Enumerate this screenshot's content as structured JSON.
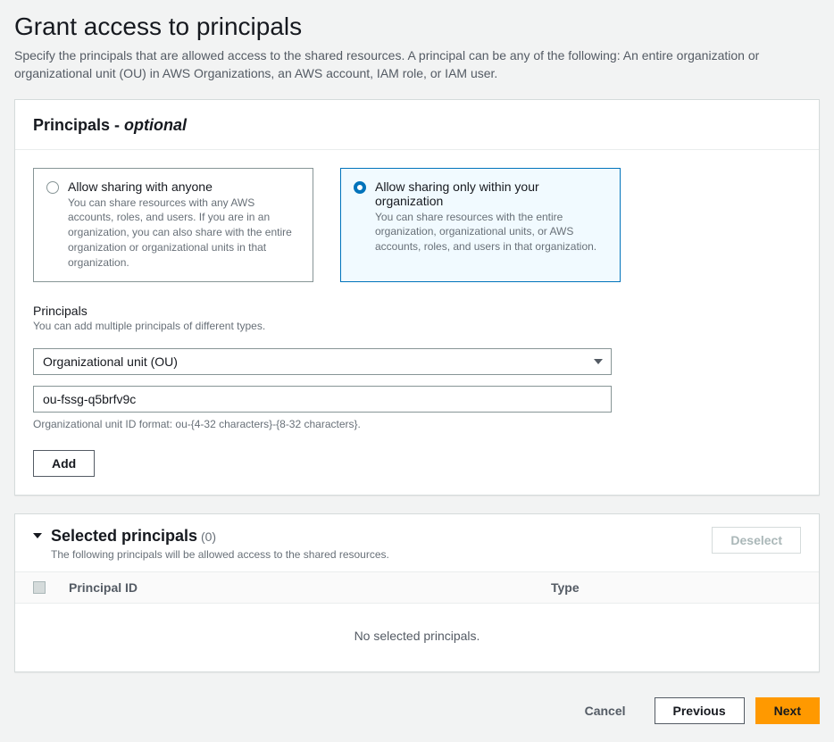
{
  "header": {
    "title": "Grant access to principals",
    "description": "Specify the principals that are allowed access to the shared resources. A principal can be any of the following: An entire organization or organizational unit (OU) in AWS Organizations, an AWS account, IAM role, or IAM user."
  },
  "principalsPanel": {
    "title_prefix": "Principals - ",
    "title_suffix": "optional",
    "options": {
      "anyone": {
        "title": "Allow sharing with anyone",
        "desc": "You can share resources with any AWS accounts, roles, and users. If you are in an organization, you can also share with the entire organization or organizational units in that organization."
      },
      "org": {
        "title": "Allow sharing only within your organization",
        "desc": "You can share resources with the entire organization, organizational units, or AWS accounts, roles, and users in that organization."
      }
    },
    "principals_label": "Principals",
    "principals_help": "You can add multiple principals of different types.",
    "select_value": "Organizational unit (OU)",
    "input_value": "ou-fssg-q5brfv9c",
    "format_hint": "Organizational unit ID format: ou-{4-32 characters}-{8-32 characters}.",
    "add_label": "Add"
  },
  "selectedPanel": {
    "title": "Selected principals",
    "count_text": "(0)",
    "desc": "The following principals will be allowed access to the shared resources.",
    "deselect_label": "Deselect",
    "col_id": "Principal ID",
    "col_type": "Type",
    "empty": "No selected principals."
  },
  "footer": {
    "cancel": "Cancel",
    "previous": "Previous",
    "next": "Next"
  }
}
